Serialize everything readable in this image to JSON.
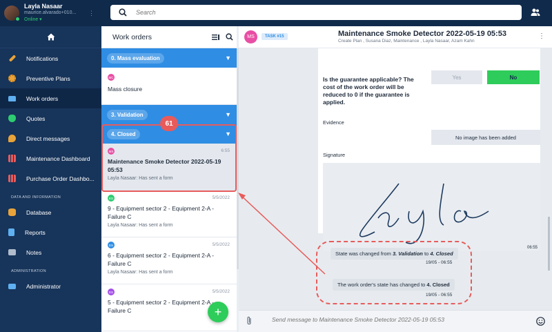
{
  "user": {
    "name": "Layla Nasaar",
    "email": "maurice.alvarado+010...",
    "status": "Online"
  },
  "search": {
    "placeholder": "Search"
  },
  "sidebar": {
    "items": [
      {
        "label": "Notifications",
        "icon": "wrench-icon",
        "color": "#e8a33a"
      },
      {
        "label": "Preventive Plans",
        "icon": "gear-icon",
        "color": "#e8a33a"
      },
      {
        "label": "Work orders",
        "icon": "briefcase-icon",
        "color": "#5fb0f0"
      },
      {
        "label": "Quotes",
        "icon": "money-bag-icon",
        "color": "#2ecc71"
      },
      {
        "label": "Direct messages",
        "icon": "chat-bubble-icon",
        "color": "#e8a33a"
      },
      {
        "label": "Maintenance Dashboard",
        "icon": "dashboard-grid-icon",
        "color": "#e85b5b"
      },
      {
        "label": "Purchase Order Dashbo...",
        "icon": "dashboard-grid-icon",
        "color": "#e85b5b"
      }
    ],
    "section_data": "DATA AND INFORMATION",
    "data_items": [
      {
        "label": "Database",
        "icon": "database-icon",
        "color": "#e8a33a"
      },
      {
        "label": "Reports",
        "icon": "document-icon",
        "color": "#5fb0f0"
      },
      {
        "label": "Notes",
        "icon": "folder-icon",
        "color": "#b0bccb"
      }
    ],
    "section_admin": "ADMINISTRATION",
    "admin_items": [
      {
        "label": "Administrator",
        "icon": "monitor-icon",
        "color": "#5fb0f0"
      }
    ]
  },
  "work_orders": {
    "title": "Work orders",
    "groups": {
      "g0": "0. Mass evaluation",
      "g3": "3. Validation",
      "g4": "4. Closed"
    },
    "mass_card": {
      "avatar": "MC",
      "title": "Mass closure"
    },
    "cards": [
      {
        "avatar": "MS",
        "avatar_color": "#e84fa4",
        "time": "6:55",
        "title": "Maintenance Smoke Detector 2022-05-19 05:53",
        "sub": "Layla Nasaar: Has sent a form"
      },
      {
        "avatar": "ES",
        "avatar_color": "#2ecc71",
        "time": "5/5/2022",
        "title": "9 - Equipment sector 2 - Equipment 2-A - Failure C",
        "sub": "Layla Nasaar: Has sent a form"
      },
      {
        "avatar": "ES",
        "avatar_color": "#2f8de4",
        "time": "5/5/2022",
        "title": "6 - Equipment sector 2 - Equipment 2-A - Failure C",
        "sub": "Layla Nasaar: Has sent a form"
      },
      {
        "avatar": "ES",
        "avatar_color": "#a44fe8",
        "time": "5/5/2022",
        "title": "5 - Equipment sector 2 - Equipment 2-A - Failure C",
        "sub": ""
      }
    ],
    "callout": "61"
  },
  "chat": {
    "avatar": "MS",
    "task_tag": "TASK #15",
    "title": "Maintenance Smoke Detector 2022-05-19 05:53",
    "subtitle": "Create Plan , Susana Diaz, Maintenance , Layla Nasaar, Azam Kahn",
    "question": "Is the guarantee applicable? The cost of the work order will be reduced to 0 if the guarantee is applied.",
    "yes": "Yes",
    "no": "No",
    "evidence_label": "Evidence",
    "no_image": "No image has been added",
    "signature_label": "Signature",
    "signature_time": "06:55",
    "msg1_pre": "State was changed from ",
    "msg1_from": "3. Validation",
    "msg1_mid": " to ",
    "msg1_to": "4. Closed",
    "msg1_time": "19/05 - 06:55",
    "msg2_pre": "The work order's state has changed to ",
    "msg2_to": "4. Closed",
    "msg2_time": "19/05 - 06:55",
    "input_placeholder": "Send message to Maintenance Smoke Detector 2022-05-19 05:53"
  }
}
